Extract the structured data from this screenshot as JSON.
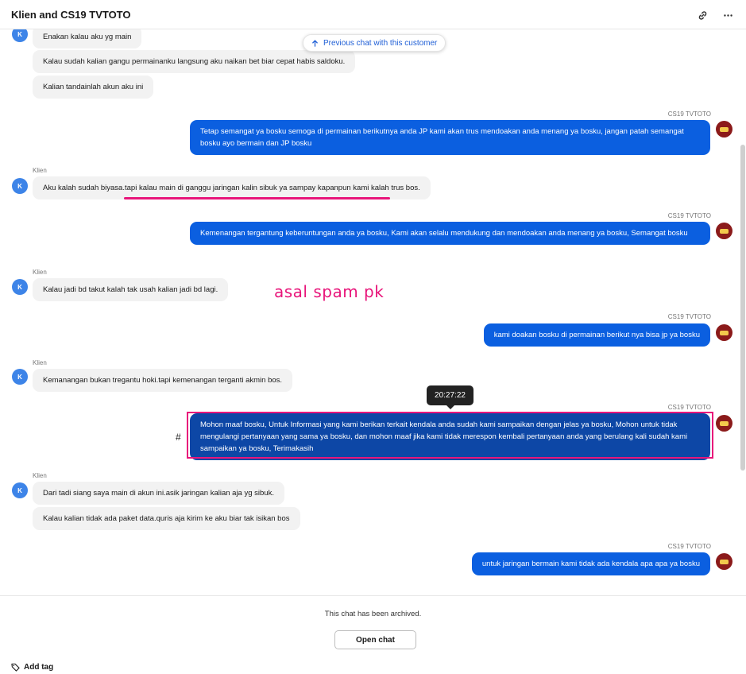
{
  "header": {
    "title": "Klien and CS19 TVTOTO",
    "link_icon": "link-icon",
    "more_icon": "more-horizontal-icon"
  },
  "previous_chat": {
    "label": "Previous chat with this customer",
    "icon": "arrow-up-icon"
  },
  "avatars": {
    "client_initial": "K"
  },
  "messages": [
    {
      "from": "client",
      "sender": "",
      "text": "Enakan kalau aku yg main"
    },
    {
      "from": "client",
      "sender": "",
      "text": "Kalau sudah kalian gangu permainanku langsung aku naikan bet biar cepat habis saldoku."
    },
    {
      "from": "client",
      "sender": "",
      "text": "Kalian tandainlah akun aku ini"
    },
    {
      "from": "agent",
      "sender": "CS19 TVTOTO",
      "text": "Tetap semangat ya bosku semoga di permainan berikutnya anda JP kami akan trus mendoakan anda menang ya bosku, jangan patah semangat bosku ayo bermain dan JP bosku"
    },
    {
      "from": "client",
      "sender": "Klien",
      "text": "Aku kalah sudah biyasa.tapi kalau main di ganggu jaringan kalin sibuk ya sampay kapanpun kami kalah trus bos."
    },
    {
      "from": "agent",
      "sender": "CS19 TVTOTO",
      "text": "Kemenangan tergantung keberuntungan anda ya bosku, Kami akan selalu mendukung dan mendoakan anda menang ya bosku, Semangat bosku"
    },
    {
      "from": "client",
      "sender": "Klien",
      "text": "Kalau jadi bd takut kalah tak usah kalian jadi bd lagi."
    },
    {
      "from": "agent",
      "sender": "CS19 TVTOTO",
      "text": "kami doakan bosku di permainan berikut nya bisa jp ya bosku"
    },
    {
      "from": "client",
      "sender": "Klien",
      "text": "Kemanangan bukan tregantu hoki.tapi kemenangan terganti akmin bos."
    },
    {
      "from": "agent",
      "sender": "CS19 TVTOTO",
      "text": "Mohon maaf bosku, Untuk Informasi yang kami berikan terkait kendala anda sudah kami sampaikan dengan jelas ya bosku, Mohon untuk tidak mengulangi pertanyaan yang sama ya bosku, dan mohon maaf jika kami tidak merespon kembali pertanyaan anda yang berulang kali sudah kami sampaikan ya bosku, Terimakasih"
    },
    {
      "from": "client",
      "sender": "Klien",
      "text": "Dari tadi siang saya main di akun ini.asik jaringan kalian aja yg sibuk."
    },
    {
      "from": "client",
      "sender": "",
      "text": "Kalau kalian tidak ada paket data.quris aja kirim ke aku biar tak isikan bos"
    },
    {
      "from": "agent",
      "sender": "CS19 TVTOTO",
      "text": "untuk jaringan bermain kami tidak ada kendala apa apa ya bosku"
    }
  ],
  "tooltip": {
    "time": "20:27:22"
  },
  "hash_mark": "#",
  "annotation": {
    "text": "asal spam pk",
    "color": "#e8157a"
  },
  "footer": {
    "archived_text": "This chat has been archived.",
    "open_chat_label": "Open chat",
    "add_tag_label": "Add tag",
    "tag_icon": "tag-icon"
  },
  "colors": {
    "agent_bubble": "#0b5fe0",
    "agent_bubble_selected": "#0d47a6",
    "client_bubble": "#f2f2f2",
    "client_avatar": "#3d84e8",
    "agent_avatar": "#8b1a1a"
  }
}
